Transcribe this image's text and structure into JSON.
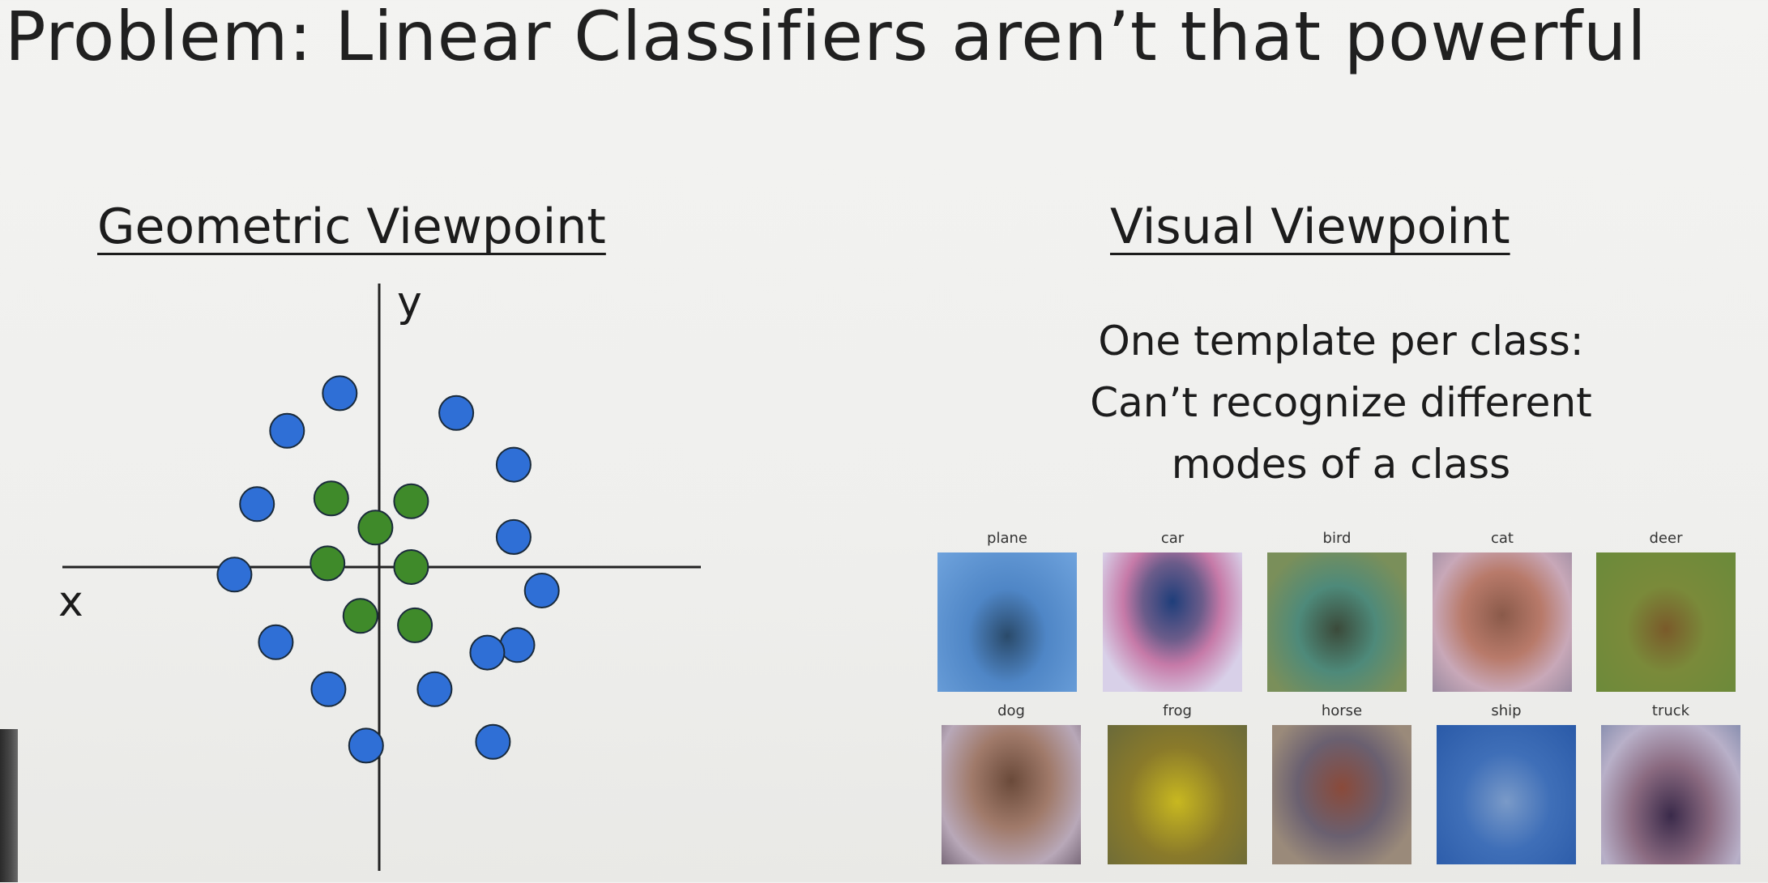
{
  "slide": {
    "title": "Problem: Linear Classifiers aren’t that powerful"
  },
  "geometric": {
    "heading": "Geometric Viewpoint",
    "x_axis_label": "x",
    "y_axis_label": "y"
  },
  "visual": {
    "heading": "Visual Viewpoint",
    "explanation_lines": [
      "One template per class:",
      "Can’t recognize different",
      "modes of a class"
    ],
    "templates": [
      "plane",
      "car",
      "bird",
      "cat",
      "deer",
      "dog",
      "frog",
      "horse",
      "ship",
      "truck"
    ]
  },
  "chart_data": {
    "type": "scatter",
    "xlabel": "x",
    "ylabel": "y",
    "xlim": [
      -3.5,
      3.5
    ],
    "ylim": [
      -3.2,
      3.2
    ],
    "grid": false,
    "colors": {
      "blue": "#2f6fd6",
      "green": "#3f8a2a"
    },
    "series": [
      {
        "color": "blue",
        "x": [
          -0.42,
          0.82,
          -0.98,
          1.43,
          -1.3,
          1.43,
          -1.54,
          1.73,
          -1.1,
          1.47,
          1.15,
          -0.54,
          0.59,
          -0.14,
          1.21
        ],
        "y": [
          1.85,
          1.64,
          1.45,
          1.09,
          0.67,
          0.32,
          -0.08,
          -0.25,
          -0.8,
          -0.83,
          -0.91,
          -1.3,
          -1.3,
          -1.9,
          -1.86
        ]
      },
      {
        "color": "green",
        "x": [
          -0.51,
          -0.04,
          0.34,
          -0.55,
          0.34,
          -0.2,
          0.38
        ],
        "y": [
          0.73,
          0.42,
          0.7,
          0.04,
          0.0,
          -0.52,
          -0.62
        ]
      }
    ]
  }
}
